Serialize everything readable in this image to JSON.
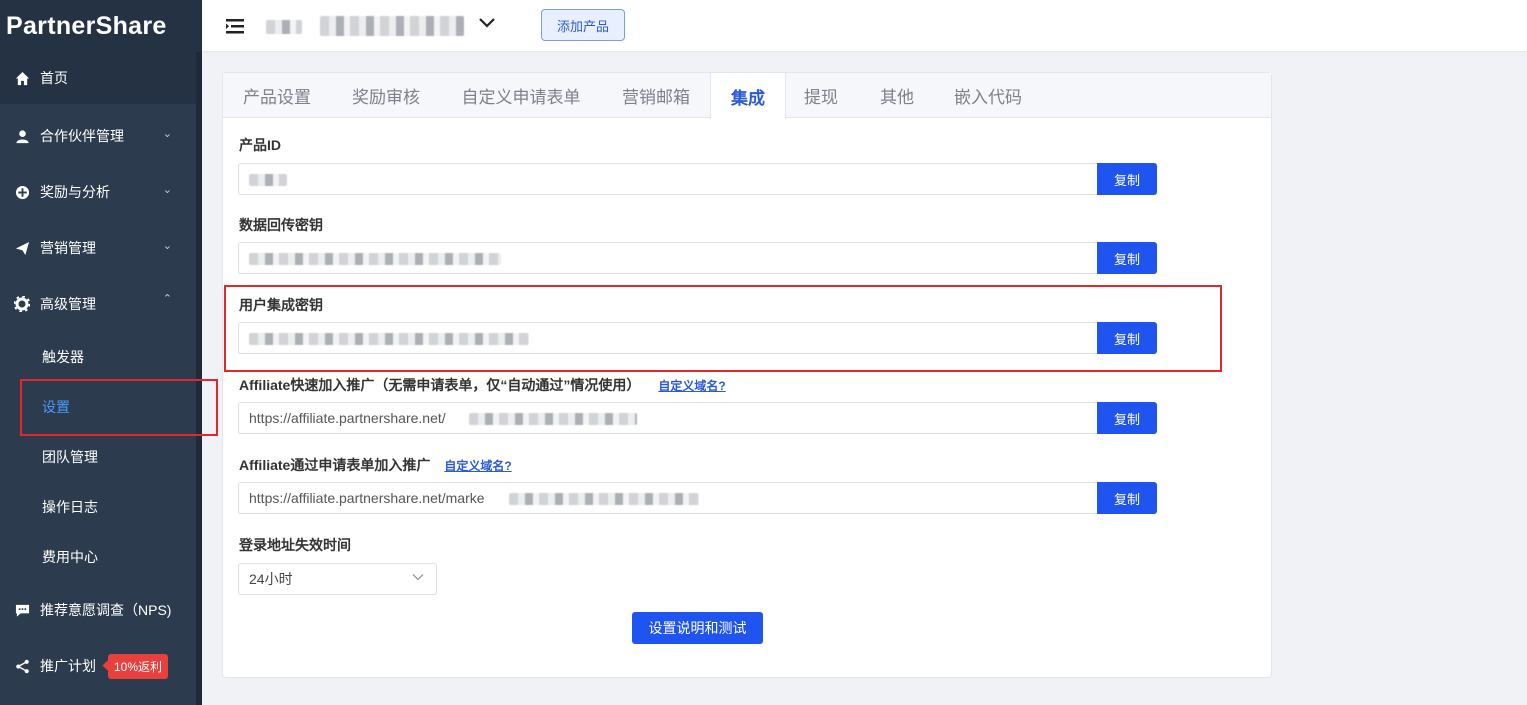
{
  "app": {
    "logo_text": "PartnerShare"
  },
  "sidebar": {
    "items": [
      {
        "label": "首页",
        "icon": "home-icon"
      },
      {
        "label": "合作伙伴管理",
        "icon": "user-icon"
      },
      {
        "label": "奖励与分析",
        "icon": "plus-circle-icon"
      },
      {
        "label": "营销管理",
        "icon": "send-icon"
      },
      {
        "label": "高级管理",
        "icon": "gear-icon"
      }
    ],
    "sub_items": [
      {
        "label": "触发器"
      },
      {
        "label": "设置"
      },
      {
        "label": "团队管理"
      },
      {
        "label": "操作日志"
      },
      {
        "label": "费用中心"
      }
    ],
    "nps": {
      "label": "推荐意愿调查（NPS)",
      "icon": "chat-icon"
    },
    "promo": {
      "label": "推广计划",
      "icon": "share-icon",
      "badge": "10%返利"
    }
  },
  "header": {
    "add_product": "添加产品"
  },
  "tabs": [
    "产品设置",
    "奖励审核",
    "自定义申请表单",
    "营销邮箱",
    "集成",
    "提现",
    "其他",
    "嵌入代码"
  ],
  "active_tab": "集成",
  "fields": {
    "product_id": {
      "label": "产品ID",
      "copy": "复制"
    },
    "postback_key": {
      "label": "数据回传密钥",
      "copy": "复制"
    },
    "user_key": {
      "label": "用户集成密钥",
      "copy": "复制"
    },
    "quick_join": {
      "label": "Affiliate快速加入推广（无需申请表单，仅“自动通过”情况使用）",
      "link": "自定义域名?",
      "value": "https://affiliate.partnershare.net/",
      "copy": "复制"
    },
    "form_join": {
      "label": "Affiliate通过申请表单加入推广",
      "link": "自定义域名?",
      "value": "https://affiliate.partnershare.net/marke",
      "copy": "复制"
    }
  },
  "expiry": {
    "label": "登录地址失效时间",
    "value": "24小时"
  },
  "test_button": "设置说明和测试",
  "colors": {
    "sidebar_bg": "#2c3b4e",
    "primary": "#1f54f0",
    "highlight_box": "#e0282e",
    "active_sub": "#4a9cff"
  }
}
